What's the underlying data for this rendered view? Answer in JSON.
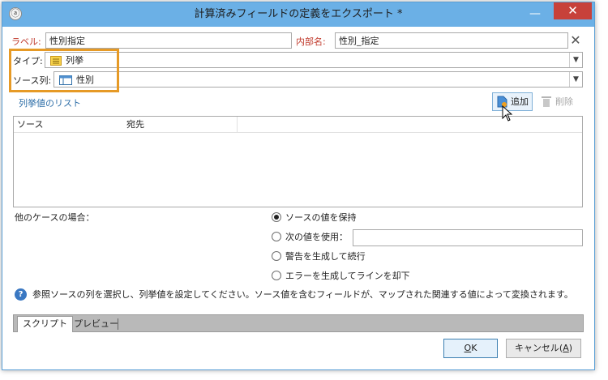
{
  "window": {
    "title": "計算済みフィールドの定義をエクスポート *",
    "minimize": "—",
    "close": "✕"
  },
  "fields": {
    "label_caption": "ラベル:",
    "label_value": "性別指定",
    "internal_name_caption": "内部名:",
    "internal_name_value": "性別_指定",
    "type_caption": "タイプ:",
    "type_value": "列挙",
    "source_column_caption": "ソース列:",
    "source_column_value": "性別"
  },
  "enum_list": {
    "section_title": "列挙値のリスト",
    "add_label": "追加",
    "delete_label": "削除",
    "columns": [
      "ソース",
      "宛先"
    ]
  },
  "other_cases": {
    "caption": "他のケースの場合：",
    "options": [
      {
        "label": "ソースの値を保持",
        "selected": true
      },
      {
        "label": "次の値を使用：",
        "selected": false
      },
      {
        "label": "警告を生成して続行",
        "selected": false
      },
      {
        "label": "エラーを生成してラインを却下",
        "selected": false
      }
    ],
    "use_value": ""
  },
  "help": {
    "icon": "?",
    "text": "参照ソースの列を選択し、列挙値を設定してください。ソース値を含むフィールドが、マップされた関連する値によって変換されます。"
  },
  "tabs": [
    {
      "label": "スクリプト",
      "active": true
    },
    {
      "label": "プレビュー",
      "active": false
    }
  ],
  "buttons": {
    "ok_key": "O",
    "ok_rest": "K",
    "cancel_prefix": "キャンセル(",
    "cancel_key": "A",
    "cancel_suffix": ")"
  },
  "colors": {
    "titlebar": "#6bb0e6",
    "close": "#c7413a",
    "highlight": "#e69a26",
    "caption_red": "#c0392b",
    "section_blue": "#2f6fa8"
  },
  "icons": {
    "type": "enum-list-icon",
    "source_column": "column-icon",
    "add": "add-document-icon",
    "delete": "trash-icon"
  }
}
